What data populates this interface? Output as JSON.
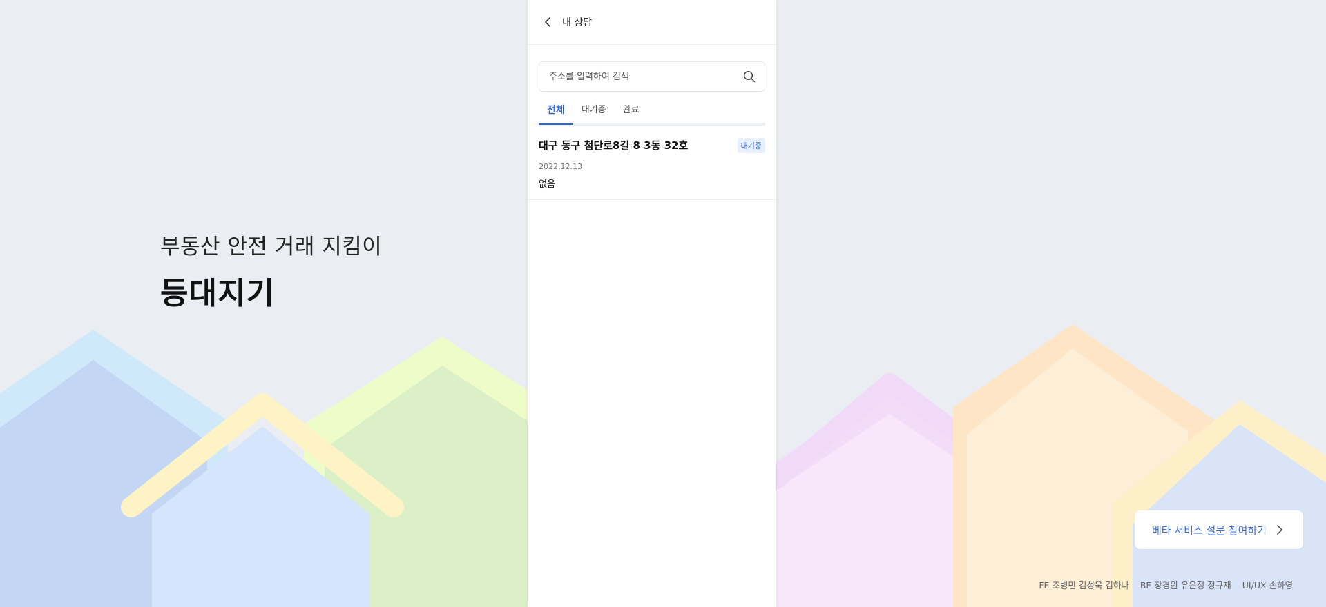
{
  "brand": {
    "subtitle": "부동산 안전 거래 지킴이",
    "title": "등대지기"
  },
  "header": {
    "back_icon": "chevron-left-icon",
    "title": "내 상담"
  },
  "search": {
    "placeholder": "주소를 입력하여 검색",
    "value": "",
    "icon": "search-icon"
  },
  "tabs": [
    {
      "label": "전체",
      "active": true
    },
    {
      "label": "대기중",
      "active": false
    },
    {
      "label": "완료",
      "active": false
    }
  ],
  "items": [
    {
      "address": "대구 동구 첨단로8길 8 3동 32호",
      "status": "대기중",
      "date": "2022.12.13",
      "memo": "없음"
    }
  ],
  "survey": {
    "label": "베타 서비스 설문 참여하기",
    "icon": "chevron-right-icon"
  },
  "credits": [
    "FE 조병민 김성욱 김하나",
    "BE 장경원 유은정 정규재",
    "UI/UX 손하영"
  ],
  "colors": {
    "accent": "#3066d8",
    "background": "#eaeef2",
    "badge_bg": "#e9f0fd"
  }
}
